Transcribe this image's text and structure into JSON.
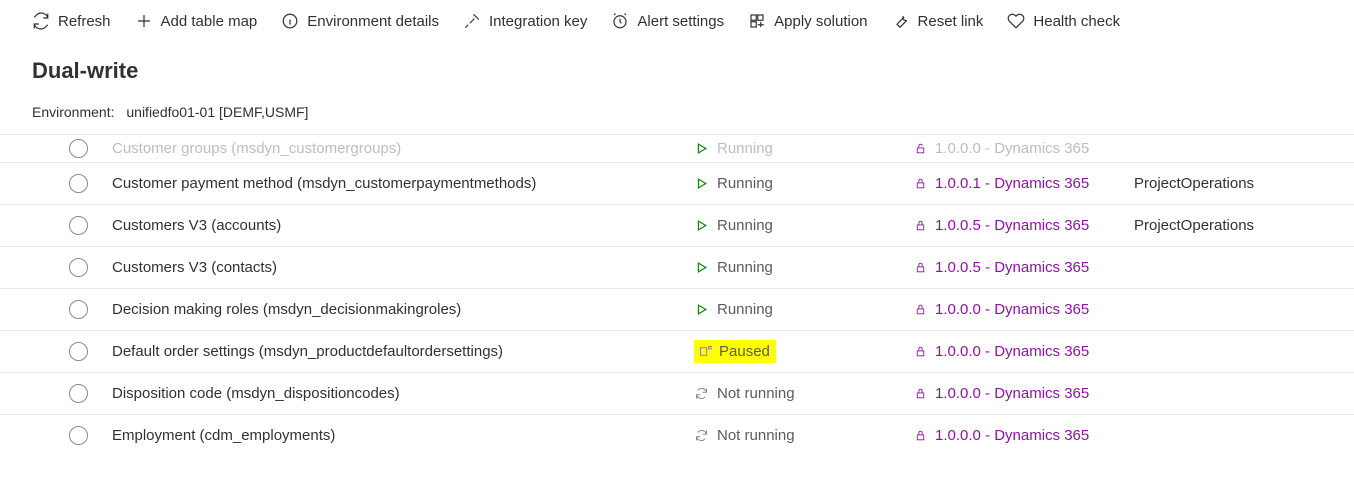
{
  "toolbar": {
    "refresh": "Refresh",
    "addTableMap": "Add table map",
    "envDetails": "Environment details",
    "integrationKey": "Integration key",
    "alertSettings": "Alert settings",
    "applySolution": "Apply solution",
    "resetLink": "Reset link",
    "healthCheck": "Health check"
  },
  "pageTitle": "Dual-write",
  "environmentLabel": "Environment:",
  "environmentValue": "unifiedfo01-01 [DEMF,USMF]",
  "rows": [
    {
      "name": "Customer groups (msdyn_customergroups)",
      "status": "Running",
      "statusKind": "running",
      "version": "1.0.0.0 - Dynamics 365",
      "publisher": "",
      "cutoff": true
    },
    {
      "name": "Customer payment method (msdyn_customerpaymentmethods)",
      "status": "Running",
      "statusKind": "running",
      "version": "1.0.0.1 - Dynamics 365",
      "publisher": "ProjectOperations"
    },
    {
      "name": "Customers V3 (accounts)",
      "status": "Running",
      "statusKind": "running",
      "version": "1.0.0.5 - Dynamics 365",
      "publisher": "ProjectOperations"
    },
    {
      "name": "Customers V3 (contacts)",
      "status": "Running",
      "statusKind": "running",
      "version": "1.0.0.5 - Dynamics 365",
      "publisher": ""
    },
    {
      "name": "Decision making roles (msdyn_decisionmakingroles)",
      "status": "Running",
      "statusKind": "running",
      "version": "1.0.0.0 - Dynamics 365",
      "publisher": ""
    },
    {
      "name": "Default order settings (msdyn_productdefaultordersettings)",
      "status": "Paused",
      "statusKind": "paused",
      "version": "1.0.0.0 - Dynamics 365",
      "publisher": ""
    },
    {
      "name": "Disposition code (msdyn_dispositioncodes)",
      "status": "Not running",
      "statusKind": "notrunning",
      "version": "1.0.0.0 - Dynamics 365",
      "publisher": ""
    },
    {
      "name": "Employment (cdm_employments)",
      "status": "Not running",
      "statusKind": "notrunning",
      "version": "1.0.0.0 - Dynamics 365",
      "publisher": ""
    }
  ]
}
